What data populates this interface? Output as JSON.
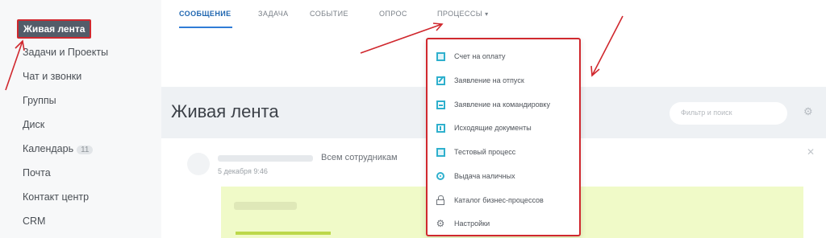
{
  "sidebar": {
    "active_label": "Живая лента",
    "items": [
      {
        "label": "Задачи и Проекты"
      },
      {
        "label": "Чат и звонки"
      },
      {
        "label": "Группы"
      },
      {
        "label": "Диск"
      },
      {
        "label": "Календарь",
        "badge": "11"
      },
      {
        "label": "Почта"
      },
      {
        "label": "Контакт центр"
      },
      {
        "label": "CRM"
      }
    ]
  },
  "tabs": [
    {
      "label": "СООБЩЕНИЕ",
      "active": true
    },
    {
      "label": "ЗАДАЧА"
    },
    {
      "label": "СОБЫТИЕ"
    },
    {
      "label": "ОПРОС"
    },
    {
      "label": "ПРОЦЕССЫ",
      "chevron": "chevron-down-icon"
    }
  ],
  "page": {
    "title": "Живая лента",
    "filter_placeholder": "Фильтр и поиск",
    "settings_icon": "gear-icon"
  },
  "post": {
    "recipients": "Всем сотрудникам",
    "date": "5 декабря 9:46",
    "close_icon": "close-icon"
  },
  "process_menu": {
    "items": [
      {
        "label": "Счет на оплату",
        "icon": "document-icon"
      },
      {
        "label": "Заявление на отпуск",
        "icon": "edit-icon"
      },
      {
        "label": "Заявление на командировку",
        "icon": "list-icon"
      },
      {
        "label": "Исходящие документы",
        "icon": "file-icon"
      },
      {
        "label": "Тестовый процесс",
        "icon": "document-icon"
      },
      {
        "label": "Выдача наличных",
        "icon": "coin-icon"
      },
      {
        "label": "Каталог бизнес-процессов",
        "icon": "lock-icon"
      },
      {
        "label": "Настройки",
        "icon": "gear-icon"
      }
    ]
  },
  "colors": {
    "annotation": "#d0282e",
    "accent": "#2f7cd6",
    "sidebar_active": "#535c69",
    "post_highlight": "#f0fac8"
  }
}
